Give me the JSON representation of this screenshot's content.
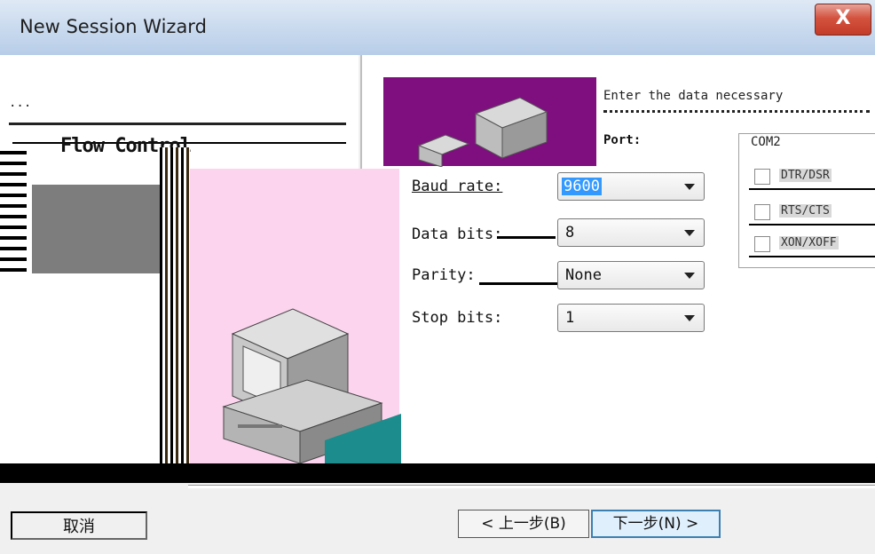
{
  "window": {
    "title": "New Session Wizard",
    "close_glyph": "X"
  },
  "ghost": {
    "prompt_text": "...",
    "flow_control_label": "Flow Control"
  },
  "header": {
    "enter_text": "Enter the data necessary",
    "port_label": "Port:"
  },
  "flow_control": {
    "port_value": "COM2",
    "options": [
      {
        "label": "DTR/DSR",
        "checked": false
      },
      {
        "label": "RTS/CTS",
        "checked": false
      },
      {
        "label": "XON/XOFF",
        "checked": false
      }
    ]
  },
  "form": {
    "baud_rate": {
      "label": "Baud rate:",
      "value": "9600"
    },
    "data_bits": {
      "label": "Data bits:",
      "value": "8"
    },
    "parity": {
      "label": "Parity:",
      "value": "None"
    },
    "stop_bits": {
      "label": "Stop bits:",
      "value": "1"
    }
  },
  "buttons": {
    "cancel": "取消",
    "back": "< 上一步(B)",
    "next": "下一步(N) >"
  },
  "icons": [
    "close-icon",
    "computer-icon",
    "chevron-down-icon"
  ]
}
